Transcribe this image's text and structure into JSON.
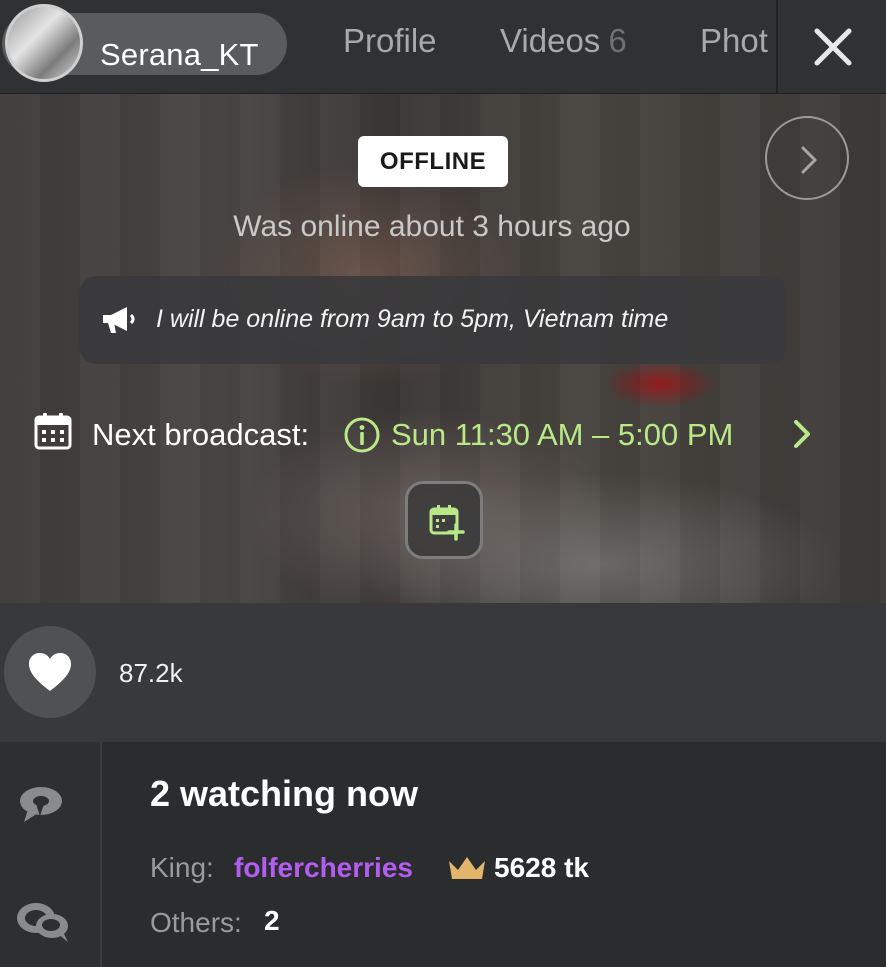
{
  "header": {
    "username": "Serana_KT",
    "tabs": [
      {
        "label": "Profile",
        "count": ""
      },
      {
        "label": "Videos",
        "count": "6"
      },
      {
        "label": "Phot",
        "count": ""
      }
    ]
  },
  "status": {
    "badge": "OFFLINE",
    "last_seen": "Was online about 3 hours ago",
    "announcement": "I will be online from 9am to 5pm, Vietnam time",
    "next_broadcast_label": "Next broadcast:",
    "next_broadcast_time": "Sun 11:30 AM – 5:00 PM"
  },
  "likes": {
    "count": "87.2k"
  },
  "watching": {
    "title": "2 watching now",
    "king_label": "King:",
    "king_name": "folfercherries",
    "king_tokens": "5628 tk",
    "others_label": "Others:",
    "others_count": "2"
  },
  "colors": {
    "accent_green": "#b8e986",
    "king_purple": "#b35cf0",
    "crown_gold": "#e3b56a",
    "background": "#2b2c2e"
  },
  "icons": [
    "close-icon",
    "chevron-right-icon",
    "megaphone-icon",
    "calendar-icon",
    "info-icon",
    "calendar-add-icon",
    "heart-icon",
    "chat-icon",
    "people-icon",
    "crown-icon"
  ]
}
